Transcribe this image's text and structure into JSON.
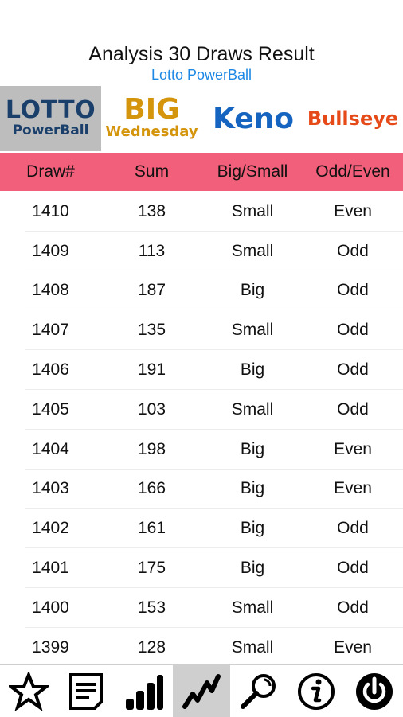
{
  "header": {
    "title": "Analysis 30 Draws Result",
    "subtitle": "Lotto PowerBall"
  },
  "games": [
    {
      "line1": "LOTTO",
      "line2": "PowerBall"
    },
    {
      "line1": "BIG",
      "line2": "Wednesday"
    },
    {
      "line1": "Keno"
    },
    {
      "line1": "Bullseye"
    }
  ],
  "selected_game": "Lotto PowerBall",
  "table": {
    "columns": [
      "Draw#",
      "Sum",
      "Big/Small",
      "Odd/Even"
    ],
    "rows": [
      [
        "1410",
        "138",
        "Small",
        "Even"
      ],
      [
        "1409",
        "113",
        "Small",
        "Odd"
      ],
      [
        "1408",
        "187",
        "Big",
        "Odd"
      ],
      [
        "1407",
        "135",
        "Small",
        "Odd"
      ],
      [
        "1406",
        "191",
        "Big",
        "Odd"
      ],
      [
        "1405",
        "103",
        "Small",
        "Odd"
      ],
      [
        "1404",
        "198",
        "Big",
        "Even"
      ],
      [
        "1403",
        "166",
        "Big",
        "Even"
      ],
      [
        "1402",
        "161",
        "Big",
        "Odd"
      ],
      [
        "1401",
        "175",
        "Big",
        "Odd"
      ],
      [
        "1400",
        "153",
        "Small",
        "Odd"
      ],
      [
        "1399",
        "128",
        "Small",
        "Even"
      ]
    ]
  },
  "bottom_nav": {
    "active": "trend-icon",
    "icons": [
      "star-icon",
      "list-icon",
      "bar-chart-icon",
      "trend-icon",
      "search-icon",
      "info-icon",
      "power-icon"
    ]
  },
  "colors": {
    "header_band": "#f25f7a",
    "subtitle": "#1e88e5",
    "big_gold": "#d4940c",
    "keno_blue": "#1565c0",
    "bullseye_red": "#e64a19",
    "lotto_navy": "#1b3f6b",
    "active_tab": "#cfcfcf"
  }
}
